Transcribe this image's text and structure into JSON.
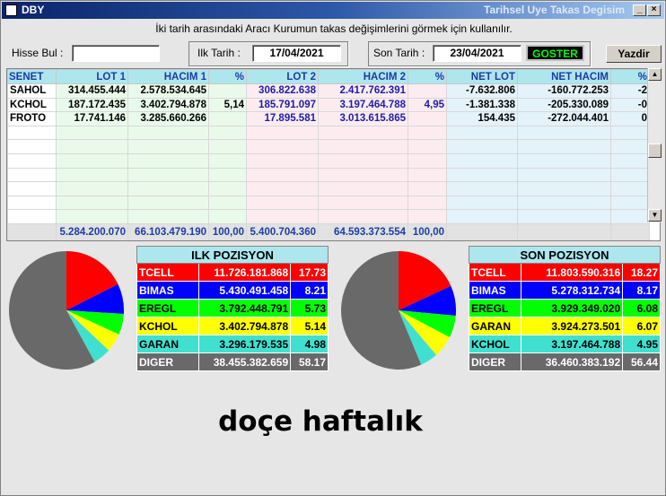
{
  "window": {
    "app_name": "DBY",
    "title": "Tarihsel Uye Takas Degisim"
  },
  "info_text": "İki tarih arasındaki  Aracı Kurumun takas değişimlerini görmek için kullanılır.",
  "filters": {
    "hisse_label": "Hisse Bul :",
    "hisse_value": "",
    "ilk_label": "Ilk Tarih :",
    "ilk_value": "17/04/2021",
    "son_label": "Son Tarih :",
    "son_value": "23/04/2021",
    "goster": "GOSTER",
    "yazdir": "Yazdir"
  },
  "grid": {
    "headers": [
      "SENET",
      "LOT 1",
      "HACIM 1",
      "%",
      "LOT 2",
      "HACIM 2",
      "%",
      "NET LOT",
      "NET HACIM",
      "%"
    ],
    "rows": [
      [
        "SAHOL",
        "314.455.444",
        "2.578.534.645",
        "",
        "306.822.638",
        "2.417.762.391",
        "",
        "-7.632.806",
        "-160.772.253",
        "-2"
      ],
      [
        "KCHOL",
        "187.172.435",
        "3.402.794.878",
        "5,14",
        "185.791.097",
        "3.197.464.788",
        "4,95",
        "-1.381.338",
        "-205.330.089",
        "-0"
      ],
      [
        "FROTO",
        "17.741.146",
        "3.285.660.266",
        "",
        "17.895.581",
        "3.013.615.865",
        "",
        "154.435",
        "-272.044.401",
        "0"
      ]
    ],
    "totals": [
      "",
      "5.284.200.070",
      "66.103.479.190",
      "100,00",
      "5.400.704.360",
      "64.593.373.554",
      "100,00",
      "",
      "",
      ""
    ]
  },
  "ilk_pozisyon": {
    "title": "ILK POZISYON",
    "rows": [
      {
        "name": "TCELL",
        "value": "11.726.181.868",
        "pct": "17.73",
        "pct_num": 17.73,
        "bg": "#ff0000",
        "fg": "#ffffff"
      },
      {
        "name": "BIMAS",
        "value": "5.430.491.458",
        "pct": "8.21",
        "pct_num": 8.21,
        "bg": "#0000ff",
        "fg": "#ffffff"
      },
      {
        "name": "EREGL",
        "value": "3.792.448.791",
        "pct": "5.73",
        "pct_num": 5.73,
        "bg": "#00ff00",
        "fg": "#000000"
      },
      {
        "name": "KCHOL",
        "value": "3.402.794.878",
        "pct": "5.14",
        "pct_num": 5.14,
        "bg": "#ffff00",
        "fg": "#000000"
      },
      {
        "name": "GARAN",
        "value": "3.296.179.535",
        "pct": "4.98",
        "pct_num": 4.98,
        "bg": "#40e0d0",
        "fg": "#000000"
      },
      {
        "name": "DIGER",
        "value": "38.455.382.659",
        "pct": "58.17",
        "pct_num": 58.17,
        "bg": "#696969",
        "fg": "#ffffff"
      }
    ]
  },
  "son_pozisyon": {
    "title": "SON POZISYON",
    "rows": [
      {
        "name": "TCELL",
        "value": "11.803.590.316",
        "pct": "18.27",
        "pct_num": 18.27,
        "bg": "#ff0000",
        "fg": "#ffffff"
      },
      {
        "name": "BIMAS",
        "value": "5.278.312.734",
        "pct": "8.17",
        "pct_num": 8.17,
        "bg": "#0000ff",
        "fg": "#ffffff"
      },
      {
        "name": "EREGL",
        "value": "3.929.349.020",
        "pct": "6.08",
        "pct_num": 6.08,
        "bg": "#00ff00",
        "fg": "#000000"
      },
      {
        "name": "GARAN",
        "value": "3.924.273.501",
        "pct": "6.07",
        "pct_num": 6.07,
        "bg": "#ffff00",
        "fg": "#000000"
      },
      {
        "name": "KCHOL",
        "value": "3.197.464.788",
        "pct": "4.95",
        "pct_num": 4.95,
        "bg": "#40e0d0",
        "fg": "#000000"
      },
      {
        "name": "DIGER",
        "value": "36.460.383.192",
        "pct": "56.44",
        "pct_num": 56.44,
        "bg": "#696969",
        "fg": "#ffffff"
      }
    ]
  },
  "caption": "doçe haftalık"
}
